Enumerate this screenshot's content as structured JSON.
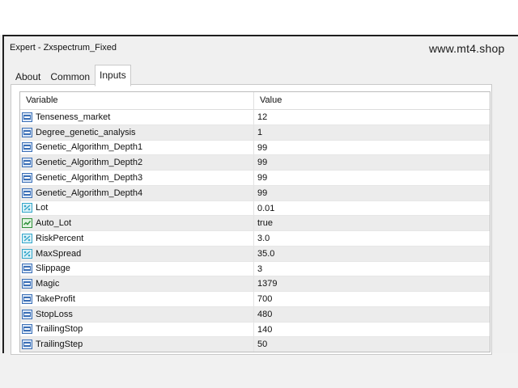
{
  "window": {
    "title": "Expert - Zxspectrum_Fixed",
    "watermark": "www.mt4.shop"
  },
  "tabs": [
    {
      "label": "About",
      "active": false
    },
    {
      "label": "Common",
      "active": false
    },
    {
      "label": "Inputs",
      "active": true
    }
  ],
  "grid": {
    "headers": {
      "variable": "Variable",
      "value": "Value"
    },
    "rows": [
      {
        "name": "Tenseness_market",
        "value": "12",
        "type": "int-icon"
      },
      {
        "name": "Degree_genetic_analysis",
        "value": "1",
        "type": "int-icon"
      },
      {
        "name": "Genetic_Algorithm_Depth1",
        "value": "99",
        "type": "int-icon"
      },
      {
        "name": "Genetic_Algorithm_Depth2",
        "value": "99",
        "type": "int-icon"
      },
      {
        "name": "Genetic_Algorithm_Depth3",
        "value": "99",
        "type": "int-icon"
      },
      {
        "name": "Genetic_Algorithm_Depth4",
        "value": "99",
        "type": "int-icon"
      },
      {
        "name": "Lot",
        "value": "0.01",
        "type": "double-icon"
      },
      {
        "name": "Auto_Lot",
        "value": "true",
        "type": "bool-icon"
      },
      {
        "name": "RiskPercent",
        "value": "3.0",
        "type": "double-icon"
      },
      {
        "name": "MaxSpread",
        "value": "35.0",
        "type": "double-icon"
      },
      {
        "name": "Slippage",
        "value": "3",
        "type": "int-icon"
      },
      {
        "name": "Magic",
        "value": "1379",
        "type": "int-icon"
      },
      {
        "name": "TakeProfit",
        "value": "700",
        "type": "int-icon"
      },
      {
        "name": "StopLoss",
        "value": "480",
        "type": "int-icon"
      },
      {
        "name": "TrailingStop",
        "value": "140",
        "type": "int-icon"
      },
      {
        "name": "TrailingStep",
        "value": "50",
        "type": "int-icon"
      }
    ]
  },
  "colors": {
    "int_icon": "#3b6fb6",
    "double_icon": "#34a6c9",
    "bool_icon": "#2f8f3a"
  }
}
